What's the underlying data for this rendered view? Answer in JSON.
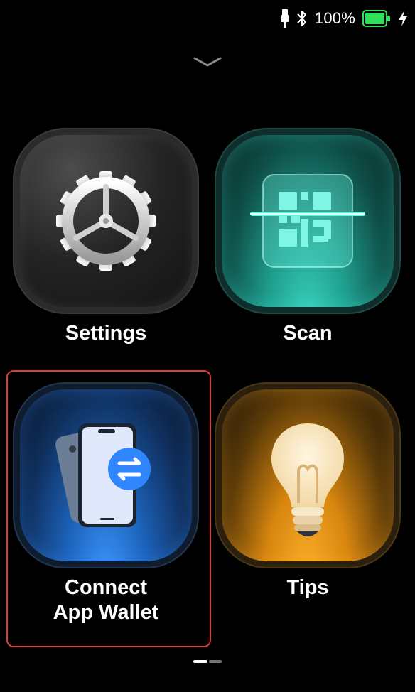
{
  "status_bar": {
    "battery_percent_text": "100%",
    "battery_level": 1.0,
    "battery_color": "#2fe05a",
    "icons": [
      "usb-icon",
      "bluetooth-icon",
      "battery-icon",
      "charging-bolt-icon"
    ]
  },
  "header": {
    "collapse_icon": "chevron-down-icon"
  },
  "apps": {
    "settings": {
      "label": "Settings",
      "icon": "gear-icon"
    },
    "scan": {
      "label": "Scan",
      "icon": "qr-scan-icon"
    },
    "connect": {
      "label_line1": "Connect",
      "label_line2": "App Wallet",
      "icon": "phone-transfer-icon"
    },
    "tips": {
      "label": "Tips",
      "icon": "lightbulb-icon"
    }
  },
  "selection": {
    "color": "#e53a33",
    "target": "Connect App Wallet"
  },
  "page_indicator": {
    "pages": 2,
    "current": 1
  },
  "colors": {
    "scan_accent": "#3ad3bf",
    "connect_accent": "#3b96ff",
    "tips_accent": "#ffb02a"
  }
}
